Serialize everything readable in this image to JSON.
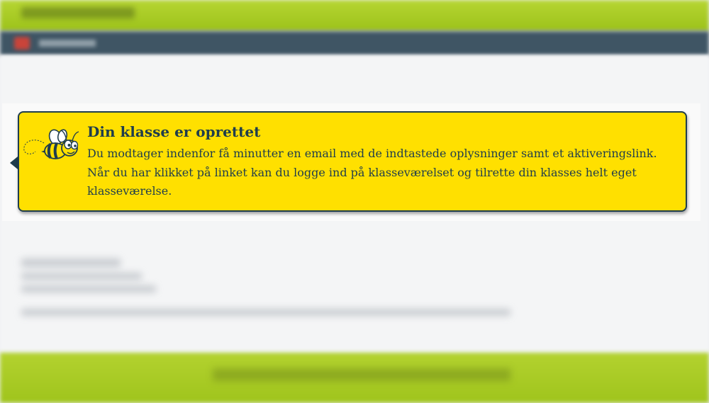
{
  "notice": {
    "title": "Din klasse er oprettet",
    "body": "Du modtager indenfor få minutter en email med de indtastede oplysninger samt et aktiveringslink. Når du har klikket på linket kan du logge ind på klasseværelset og tilrette din klasses helt eget klasseværelse.",
    "icon": "bee-icon",
    "colors": {
      "background": "#ffe000",
      "border": "#1f3d4d",
      "text": "#1f3d4d"
    }
  },
  "background": {
    "top_bar_color": "#b6d532",
    "nav_bar_color": "#3f5564",
    "bottom_bar_color": "#b3d22f"
  }
}
